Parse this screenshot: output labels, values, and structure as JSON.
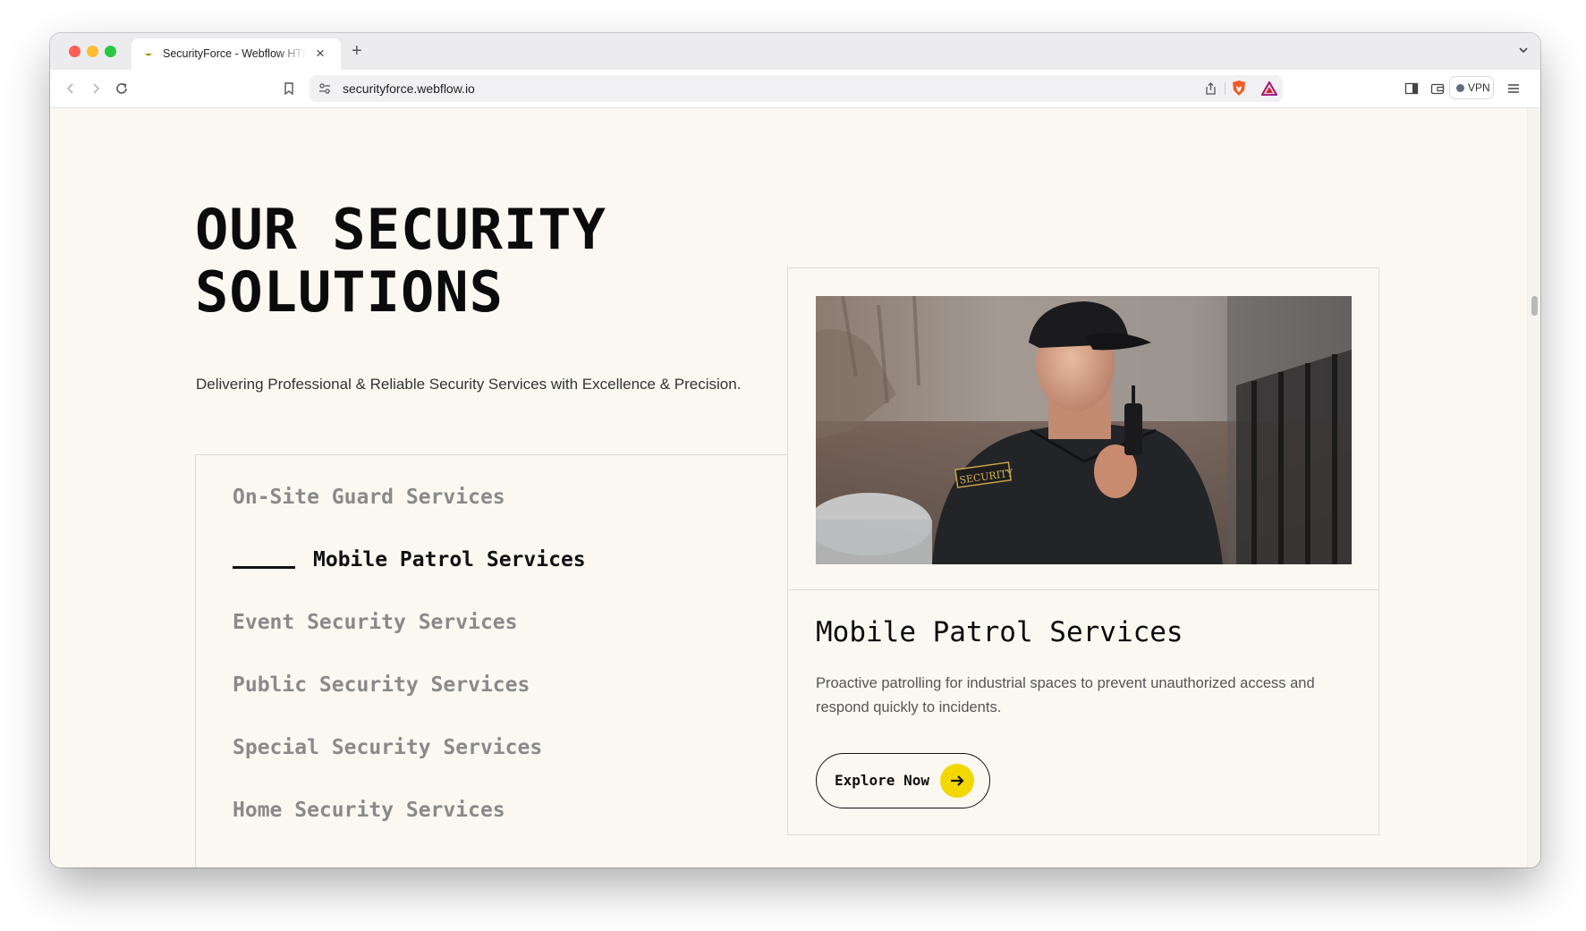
{
  "browser": {
    "tab_title": "SecurityForce - Webflow HTML",
    "url": "securityforce.webflow.io",
    "vpn_label": "VPN"
  },
  "hero": {
    "heading_line1": "OUR SECURITY",
    "heading_line2": "SOLUTIONS",
    "subtitle": "Delivering Professional & Reliable Security Services with Excellence & Precision."
  },
  "services": [
    {
      "label": "On-Site Guard Services",
      "active": false
    },
    {
      "label": "Mobile Patrol Services",
      "active": true
    },
    {
      "label": "Event Security Services",
      "active": false
    },
    {
      "label": "Public Security Services",
      "active": false
    },
    {
      "label": "Special Security Services",
      "active": false
    },
    {
      "label": "Home Security Services",
      "active": false
    }
  ],
  "card": {
    "title": "Mobile Patrol Services",
    "description": "Proactive patrolling for industrial spaces to prevent unauthorized access and respond quickly to incidents.",
    "button_label": "Explore Now",
    "image_badge": "SECURITY"
  },
  "colors": {
    "accent": "#f2d800",
    "background": "#faf8f1",
    "text": "#0b0b0b",
    "muted": "#8a8a8a"
  }
}
